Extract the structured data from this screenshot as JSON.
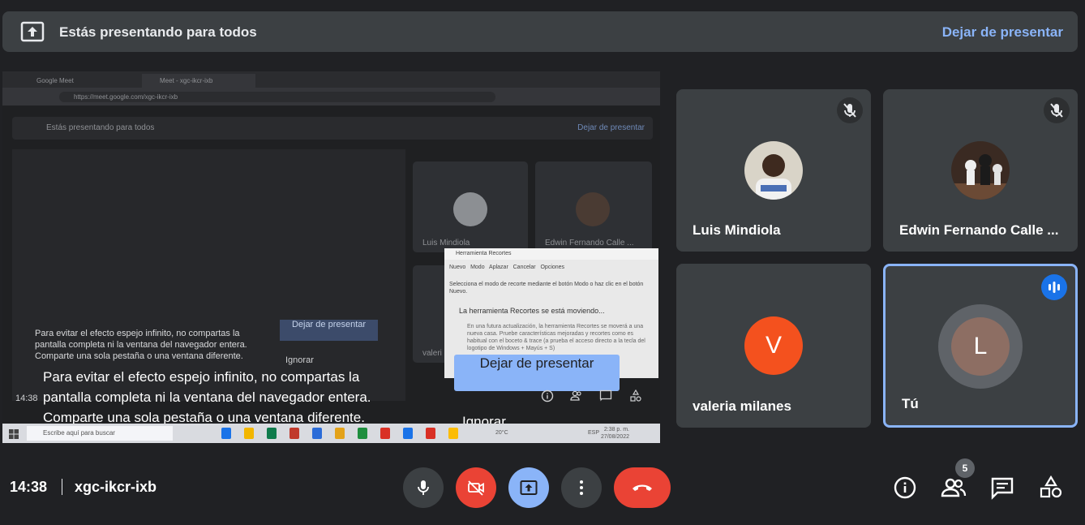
{
  "banner": {
    "title": "Estás presentando para todos",
    "stop_label": "Dejar de presentar"
  },
  "preview": {
    "browser_tabs": [
      "Google Meet",
      "Meet - xgc-ikcr-ixb"
    ],
    "url": "https://meet.google.com/xgc-ikcr-ixb",
    "inner_banner_title": "Estás presentando para todos",
    "inner_banner_stop": "Dejar de presentar",
    "inner_tiles": [
      "Luis Mindiola",
      "Edwin Fernando Calle ...",
      "valeri"
    ],
    "snip_tool": {
      "title": "Herramienta Recortes",
      "buttons": [
        "Nuevo",
        "Modo",
        "Aplazar",
        "Cancelar",
        "Opciones"
      ],
      "instruction": "Selecciona el modo de recorte mediante el botón Modo o haz clic en el botón Nuevo.",
      "heading": "La herramienta Recortes se está moviendo...",
      "body": "En una futura actualización, la herramienta Recortes se moverá a una nueva casa. Pruebe características mejoradas y recortes como es habitual con el boceto & trace (a prueba el acceso directo a la tecla del logotipo de Windows + Mayús + S)"
    },
    "small_warning": "Para evitar el efecto espejo infinito, no compartas la pantalla completa ni la ventana del navegador entera. Comparte una sola pestaña o una ventana diferente.",
    "small_stop": "Dejar de presentar",
    "small_ignore": "Ignorar",
    "big_warning_lines": [
      "Para evitar el efecto espejo infinito, no compartas la",
      "pantalla completa ni la ventana del navegador entera.",
      "Comparte una sola pestaña o una ventana diferente."
    ],
    "big_stop": "Dejar de presentar",
    "big_ignore": "Ignorar",
    "inner_clock": "14:38",
    "taskbar_search": "Escribe aquí para buscar",
    "taskbar_lang": "ESP",
    "taskbar_temp": "20°C",
    "taskbar_time": "2:38 p. m.",
    "taskbar_date": "27/08/2022"
  },
  "participants": [
    {
      "name": "Luis Mindiola",
      "muted": true
    },
    {
      "name": "Edwin Fernando Calle ...",
      "muted": true
    },
    {
      "name": "valeria milanes",
      "initial": "V",
      "color": "#f4511e"
    },
    {
      "name": "Tú",
      "initial": "L",
      "color": "#8d6e63",
      "speaking": true
    }
  ],
  "bottom": {
    "time": "14:38",
    "meeting_code": "xgc-ikcr-ixb",
    "people_count": "5",
    "controls": [
      "mic-icon",
      "camera-off-icon",
      "present-icon",
      "more-options-icon",
      "end-call-icon"
    ],
    "right_icons": [
      "info-icon",
      "people-icon",
      "chat-icon",
      "activities-icon"
    ]
  },
  "colors": {
    "background": "#202124",
    "surface": "#3c4043",
    "accent": "#8ab4f8",
    "danger": "#ea4335"
  }
}
